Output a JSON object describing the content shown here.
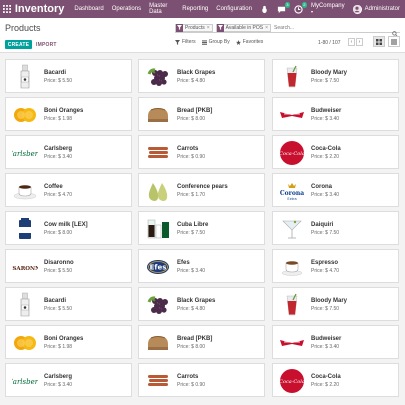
{
  "navbar": {
    "brand": "Inventory",
    "menu": [
      "Dashboard",
      "Operations",
      "Master Data",
      "Reporting",
      "Configuration"
    ],
    "chat_badge": "3",
    "activity_badge": "2",
    "company": "MyCompany",
    "user": "Administrator"
  },
  "control": {
    "title": "Products",
    "create_label": "CREATE",
    "import_label": "IMPORT",
    "facets": [
      {
        "label": "Products",
        "icon": "filter-icon"
      },
      {
        "label": "Available in POS",
        "icon": "filter-icon"
      }
    ],
    "search_placeholder": "Search...",
    "filters_label": "Filters",
    "groupby_label": "Group By",
    "favorites_label": "Favorites",
    "pager": "1-80 / 107"
  },
  "products": [
    {
      "name": "Bacardi",
      "price": "Price: $ 5.50",
      "icon": "bottle"
    },
    {
      "name": "Black Grapes",
      "price": "Price: $ 4.80",
      "icon": "grapes"
    },
    {
      "name": "Bloody Mary",
      "price": "Price: $ 7.50",
      "icon": "cocktail-red"
    },
    {
      "name": "Boni Oranges",
      "price": "Price: $ 1.98",
      "icon": "oranges"
    },
    {
      "name": "Bread [PKB]",
      "price": "Price: $ 8.00",
      "icon": "bread"
    },
    {
      "name": "Budweiser",
      "price": "Price: $ 3.40",
      "icon": "bud-logo"
    },
    {
      "name": "Carlsberg",
      "price": "Price: $ 3.40",
      "icon": "carlsberg-logo"
    },
    {
      "name": "Carrots",
      "price": "Price: $ 0.90",
      "icon": "carrots"
    },
    {
      "name": "Coca-Cola",
      "price": "Price: $ 2.20",
      "icon": "coke-logo"
    },
    {
      "name": "Coffee",
      "price": "Price: $ 4.70",
      "icon": "coffee-cup"
    },
    {
      "name": "Conference pears",
      "price": "Price: $ 1.70",
      "icon": "pears"
    },
    {
      "name": "Corona",
      "price": "Price: $ 3.40",
      "icon": "corona-logo"
    },
    {
      "name": "Cow milk [LEX]",
      "price": "Price: $ 8.00",
      "icon": "milk"
    },
    {
      "name": "Cuba Libre",
      "price": "Price: $ 7.50",
      "icon": "cuba-libre"
    },
    {
      "name": "Daiquiri",
      "price": "Price: $ 7.50",
      "icon": "martini"
    },
    {
      "name": "Disaronno",
      "price": "Price: $ 5.50",
      "icon": "disaronno-logo"
    },
    {
      "name": "Efes",
      "price": "Price: $ 3.40",
      "icon": "efes-logo"
    },
    {
      "name": "Espresso",
      "price": "Price: $ 4.70",
      "icon": "espresso"
    },
    {
      "name": "Bacardi",
      "price": "Price: $ 5.50",
      "icon": "bottle"
    },
    {
      "name": "Black Grapes",
      "price": "Price: $ 4.80",
      "icon": "grapes"
    },
    {
      "name": "Bloody Mary",
      "price": "Price: $ 7.50",
      "icon": "cocktail-red"
    },
    {
      "name": "Boni Oranges",
      "price": "Price: $ 1.98",
      "icon": "oranges"
    },
    {
      "name": "Bread [PKB]",
      "price": "Price: $ 8.00",
      "icon": "bread"
    },
    {
      "name": "Budweiser",
      "price": "Price: $ 3.40",
      "icon": "bud-logo"
    },
    {
      "name": "Carlsberg",
      "price": "Price: $ 3.40",
      "icon": "carlsberg-logo"
    },
    {
      "name": "Carrots",
      "price": "Price: $ 0.90",
      "icon": "carrots"
    },
    {
      "name": "Coca-Cola",
      "price": "Price: $ 2.20",
      "icon": "coke-logo"
    }
  ],
  "colors": {
    "navbar": "#7c5072",
    "create_button": "#00a09d",
    "background": "#f3f3f3"
  }
}
